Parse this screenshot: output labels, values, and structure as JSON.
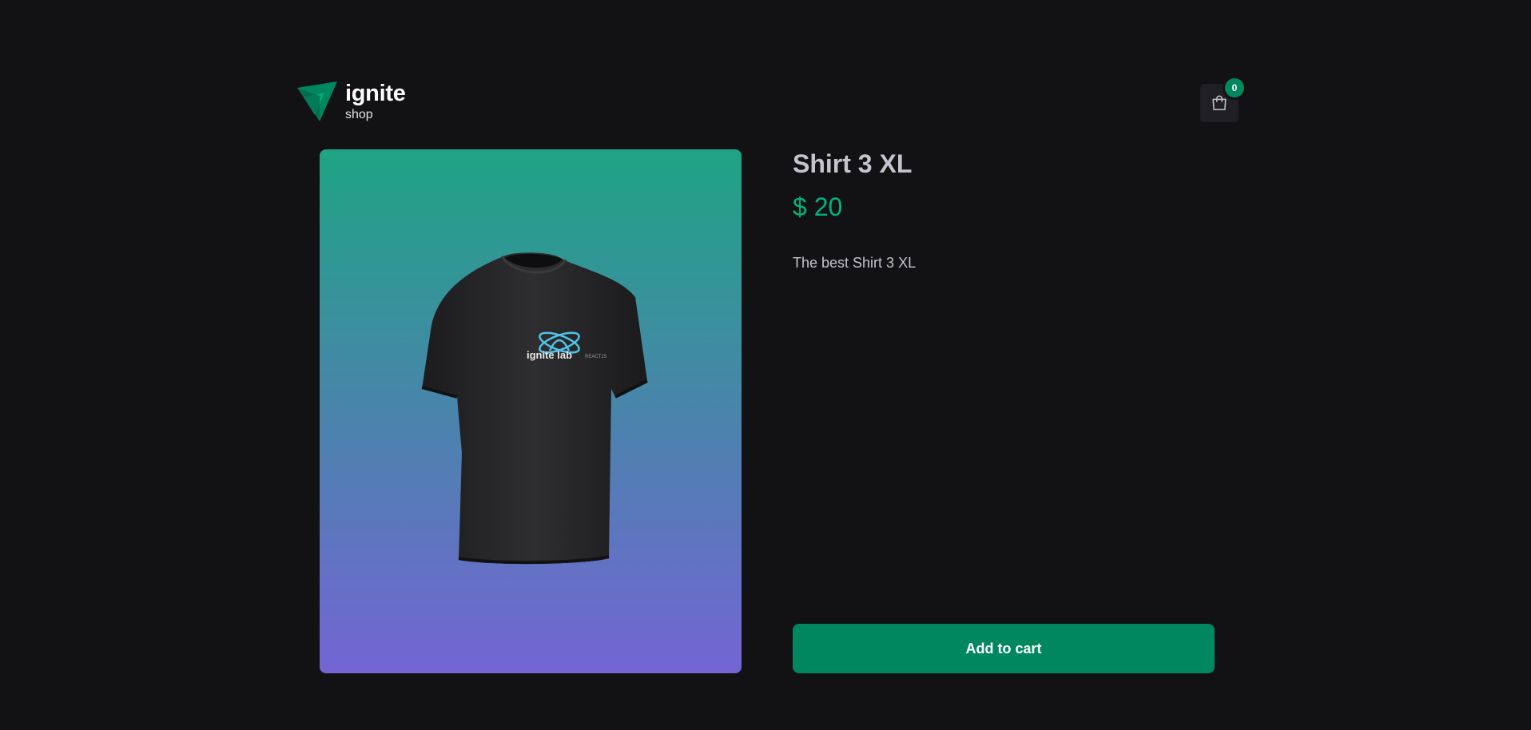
{
  "header": {
    "logo_title": "ignite",
    "logo_subtitle": "shop",
    "cart_count": "0",
    "cart_icon": "shopping-bag-icon"
  },
  "product": {
    "title": "Shirt 3 XL",
    "price": "$ 20",
    "description": "The best Shirt 3 XL",
    "add_to_cart_label": "Add to cart",
    "shirt_print_text": "ignite lab",
    "shirt_print_sub": "REACTJS"
  },
  "colors": {
    "background": "#121214",
    "accent": "#00875f",
    "price": "#00b37e",
    "text": "#c4c4cc",
    "gradient_top": "#1ea483",
    "gradient_bottom": "#7465d4"
  }
}
